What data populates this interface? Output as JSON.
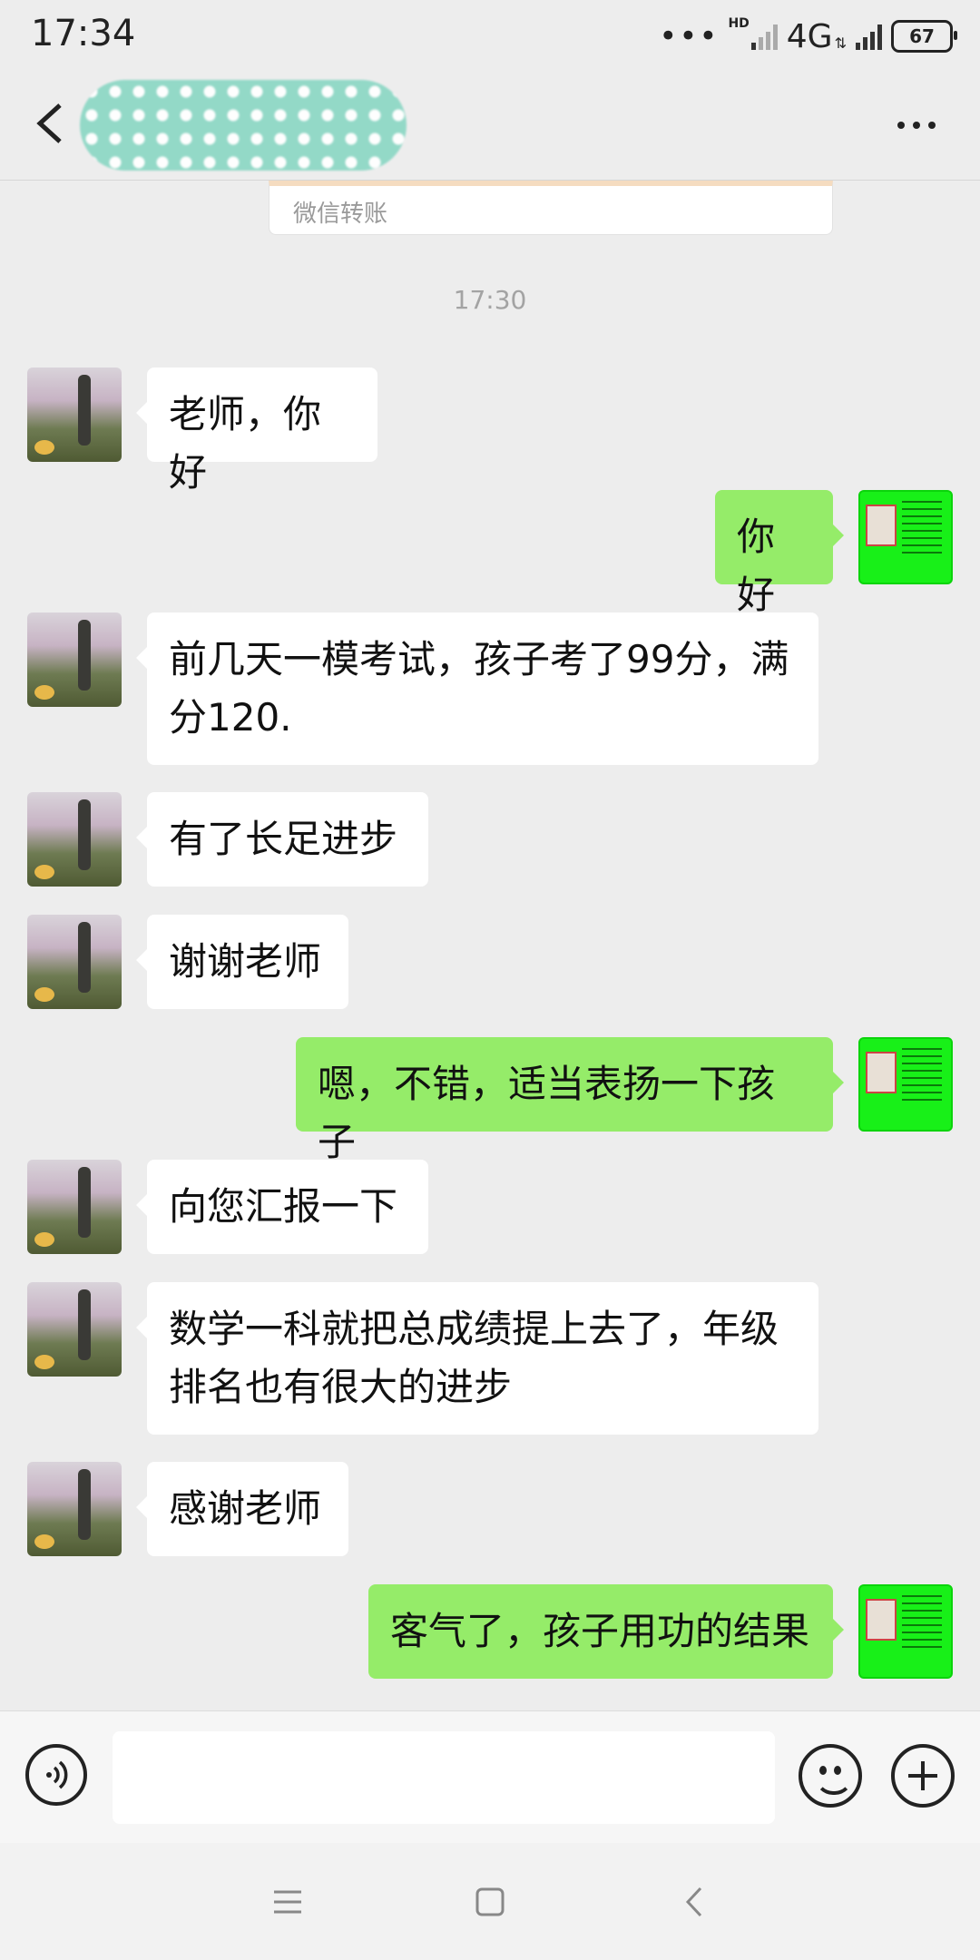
{
  "status_bar": {
    "time": "17:34",
    "hd_label": "HD",
    "network": "4G",
    "battery": "67"
  },
  "header": {
    "contact_name": "",
    "back_icon": "chevron-left-icon",
    "more_icon": "more-horizontal-icon"
  },
  "chat": {
    "transfer_label": "微信转账",
    "timestamp": "17:30",
    "messages": [
      {
        "from": "other",
        "text": "老师，你好"
      },
      {
        "from": "me",
        "text": "你好"
      },
      {
        "from": "other",
        "text": "前几天一模考试，孩子考了99分，满分120."
      },
      {
        "from": "other",
        "text": "有了长足进步"
      },
      {
        "from": "other",
        "text": "谢谢老师"
      },
      {
        "from": "me",
        "text": "嗯，不错，适当表扬一下孩子"
      },
      {
        "from": "other",
        "text": "向您汇报一下"
      },
      {
        "from": "other",
        "text": "数学一科就把总成绩提上去了，年级排名也有很大的进步"
      },
      {
        "from": "other",
        "text": "感谢老师"
      },
      {
        "from": "me",
        "text": "客气了，孩子用功的结果"
      }
    ]
  },
  "input_bar": {
    "text_value": "",
    "voice_icon": "voice-icon",
    "emoji_icon": "emoji-icon",
    "plus_icon": "plus-icon"
  },
  "system_nav": {
    "menu_icon": "menu-icon",
    "home_icon": "home-icon",
    "back_icon": "back-icon"
  },
  "colors": {
    "background": "#ededed",
    "my_bubble": "#95ec69",
    "other_bubble": "#ffffff"
  }
}
